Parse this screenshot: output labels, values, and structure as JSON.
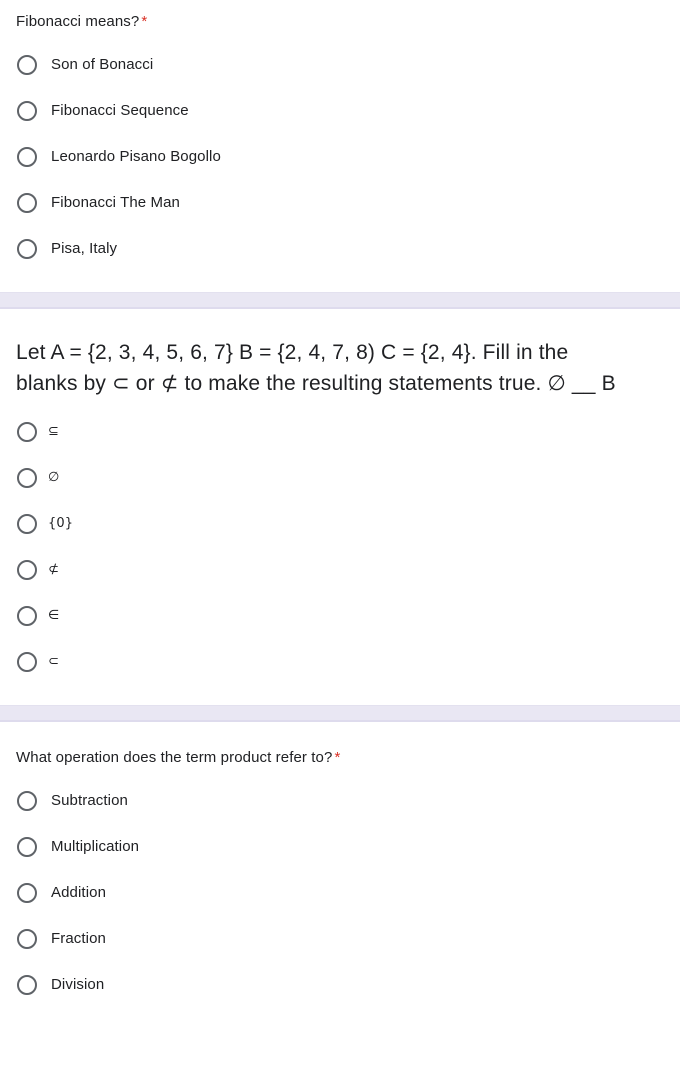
{
  "form": {
    "questions": [
      {
        "id": "q-fibonacci-means",
        "title": "Fibonacci means?",
        "required": true,
        "required_marker": "*",
        "title_size": "normal",
        "options": [
          "Son of Bonacci",
          "Fibonacci Sequence",
          "Leonardo Pisano Bogollo",
          "Fibonacci The Man",
          "Pisa, Italy"
        ]
      },
      {
        "id": "q-set-subset-blanks",
        "title": "Let A = {2, 3, 4, 5, 6, 7} B = {2, 4, 7, 8) C = {2, 4}. Fill in the blanks by ⊂ or ⊄ to make the resulting statements true. ∅ __ B",
        "title_line_1": "Let A = {2, 3, 4, 5, 6, 7} B = {2, 4, 7, 8) C = {2, 4}. Fill in the",
        "title_line_2": "blanks by ⊂ or ⊄ to make the resulting statements true. ∅ __ B",
        "required": false,
        "required_marker": "",
        "title_size": "large",
        "options": [
          "⊆",
          "∅",
          "{0}",
          "⊄",
          "∈",
          "⊂"
        ]
      },
      {
        "id": "q-product-operation",
        "title": "What operation does the term product refer to?",
        "required": true,
        "required_marker": "*",
        "title_size": "normal",
        "options": [
          "Subtraction",
          "Multiplication",
          "Addition",
          "Fraction",
          "Division"
        ]
      }
    ]
  },
  "colors": {
    "required_star": "#d93025",
    "section_divider": "#e9e7f3",
    "radio_outline": "#5f6368",
    "text": "#202124",
    "background": "#ffffff"
  }
}
